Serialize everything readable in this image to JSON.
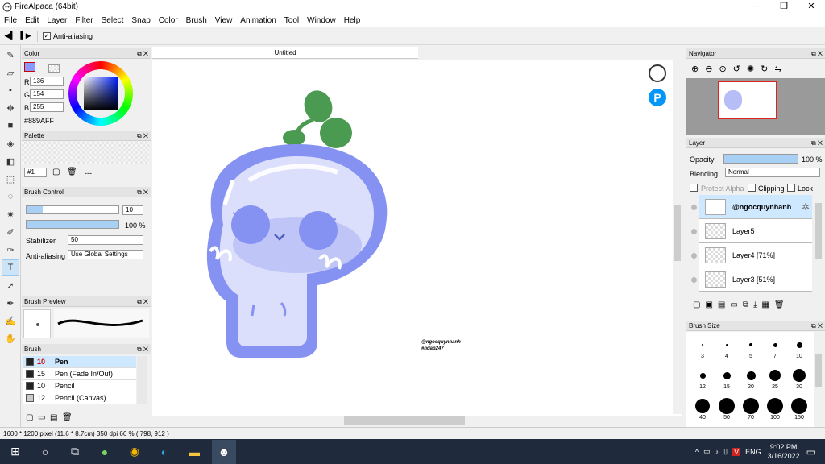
{
  "app": {
    "title": "FireAlpaca (64bit)"
  },
  "menu": [
    "File",
    "Edit",
    "Layer",
    "Filter",
    "Select",
    "Snap",
    "Color",
    "Brush",
    "View",
    "Animation",
    "Tool",
    "Window",
    "Help"
  ],
  "options": {
    "antialias_label": "Anti-aliasing"
  },
  "document": {
    "tab_title": "Untitled"
  },
  "color_panel": {
    "title": "Color",
    "r_label": "R",
    "g_label": "G",
    "b_label": "B",
    "r": "136",
    "g": "154",
    "b": "255",
    "hex": "#889AFF",
    "color": "#889AFF"
  },
  "palette_panel": {
    "title": "Palette",
    "set": "#1",
    "dash": "---"
  },
  "brush_control": {
    "title": "Brush Control",
    "size": "10",
    "opacity": "100 %",
    "stabilizer_label": "Stabilizer",
    "stabilizer": "50",
    "aa_label": "Anti-aliasing",
    "aa_value": "Use Global Settings"
  },
  "brush_preview": {
    "title": "Brush Preview"
  },
  "brush_panel": {
    "title": "Brush",
    "items": [
      {
        "size": "10",
        "name": "Pen"
      },
      {
        "size": "15",
        "name": "Pen (Fade In/Out)"
      },
      {
        "size": "10",
        "name": "Pencil"
      },
      {
        "size": "12",
        "name": "Pencil (Canvas)"
      }
    ]
  },
  "canvas": {
    "watermark1": "@ngocquynhanh",
    "watermark2": "#hdap247"
  },
  "navigator": {
    "title": "Navigator"
  },
  "layer_panel": {
    "title": "Layer",
    "opacity_label": "Opacity",
    "opacity": "100 %",
    "blending_label": "Blending",
    "blending": "Normal",
    "protect_alpha": "Protect Alpha",
    "clipping": "Clipping",
    "lock": "Lock",
    "layers": [
      "@ngocquynhanh",
      "Layer5",
      "Layer4 [71%]",
      "Layer3 [51%]"
    ]
  },
  "brush_size_panel": {
    "title": "Brush Size",
    "sizes": [
      "3",
      "4",
      "5",
      "7",
      "10",
      "12",
      "15",
      "20",
      "25",
      "30",
      "40",
      "50",
      "70",
      "100",
      "150"
    ]
  },
  "status": {
    "text": "1600 * 1200 pixel   (11.6 * 8.7cm)   350 dpi   66 %   ( 798, 912 )"
  },
  "taskbar": {
    "time": "9:02 PM",
    "date": "3/16/2022",
    "lang": "ENG"
  }
}
